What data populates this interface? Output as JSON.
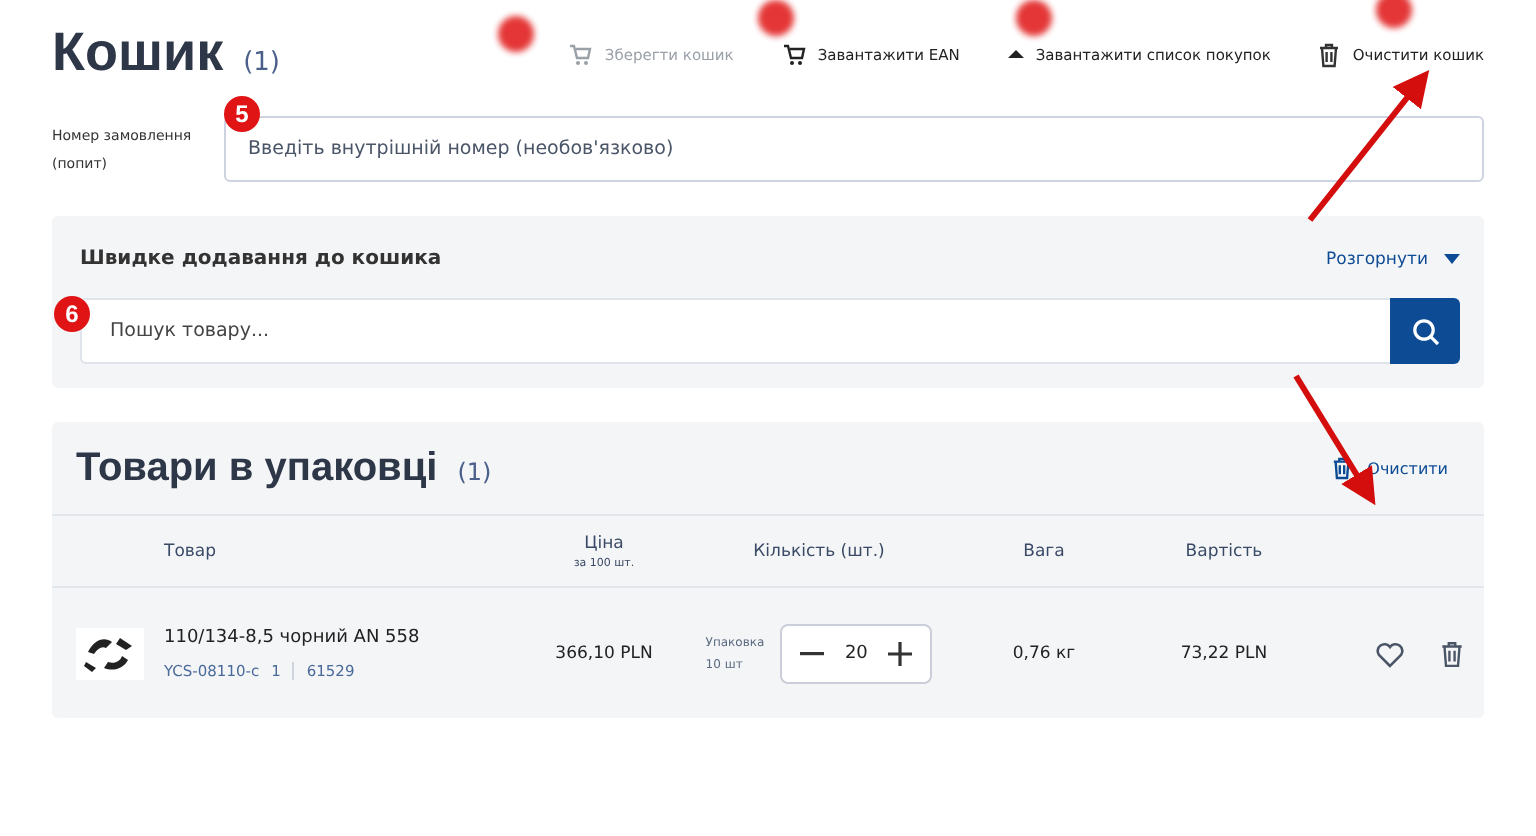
{
  "header": {
    "title": "Кошик",
    "count": "(1)"
  },
  "toolbar": [
    {
      "label": "Зберегти кошик",
      "disabled": true
    },
    {
      "label": "Завантажити EAN",
      "disabled": false
    },
    {
      "label": "Завантажити список покупок",
      "disabled": false
    },
    {
      "label": "Очистити кошик",
      "disabled": false
    }
  ],
  "order_number": {
    "label": "Номер замовлення (попит)",
    "placeholder": "Введіть внутрішній номер (необов'язково)"
  },
  "quick_add": {
    "title": "Швидке додавання до кошика",
    "expand_label": "Розгорнути",
    "search_placeholder": "Пошук товару..."
  },
  "package": {
    "title": "Товари в упаковці",
    "count": "(1)",
    "clear_label": "Очистити",
    "columns": [
      {
        "label": "Товар"
      },
      {
        "label": "Ціна",
        "sub": "за 100 шт."
      },
      {
        "label": "Кількість (шт.)"
      },
      {
        "label": "Вага"
      },
      {
        "label": "Вартість"
      }
    ],
    "rows": [
      {
        "name": "110/134-8,5 чорний AN 558",
        "code": "YCS-08110-c",
        "code_count": "1",
        "code_2": "61529",
        "price": "366,10 PLN",
        "pack_label": "Упаковка",
        "pack_size": "10 шт",
        "quantity": "20",
        "weight": "0,76 кг",
        "value": "73,22 PLN"
      }
    ]
  },
  "markers": [
    {
      "label": "5"
    },
    {
      "label": "6"
    }
  ]
}
